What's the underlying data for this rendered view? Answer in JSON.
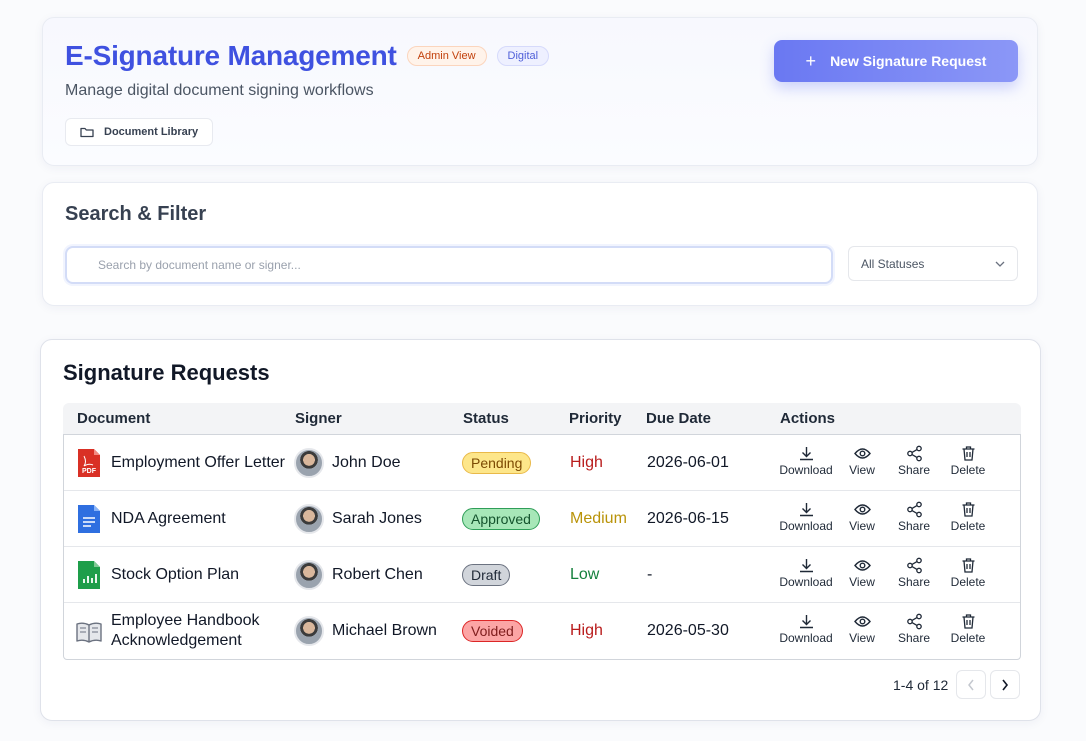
{
  "header": {
    "title": "E-Signature Management",
    "badges": [
      "Admin View",
      "Digital"
    ],
    "subtitle": "Manage digital document signing workflows",
    "doc_library_label": "Document Library",
    "new_request_label": "New Signature Request"
  },
  "search": {
    "title": "Search & Filter",
    "placeholder": "Search by document name or signer...",
    "status_filter": "All Statuses"
  },
  "table": {
    "title": "Signature Requests",
    "columns": [
      "Document",
      "Signer",
      "Status",
      "Priority",
      "Due Date",
      "Actions"
    ],
    "rows": [
      {
        "document": "Employment Offer Letter",
        "doc_icon": "pdf-icon",
        "signer": "John Doe",
        "status": "Pending",
        "priority": "High",
        "due_date": "2026-06-01"
      },
      {
        "document": "NDA Agreement",
        "doc_icon": "doc-icon",
        "signer": "Sarah Jones",
        "status": "Approved",
        "priority": "Medium",
        "due_date": "2026-06-15"
      },
      {
        "document": "Stock Option Plan",
        "doc_icon": "spreadsheet-icon",
        "signer": "Robert Chen",
        "status": "Draft",
        "priority": "Low",
        "due_date": "-"
      },
      {
        "document": "Employee Handbook Acknowledgement",
        "doc_icon": "book-icon",
        "signer": "Michael Brown",
        "status": "Voided",
        "priority": "High",
        "due_date": "2026-05-30"
      }
    ],
    "actions": [
      "Download",
      "View",
      "Share",
      "Delete"
    ],
    "pagination": "1-4 of 12"
  },
  "colors": {
    "accent": "#3f51e0",
    "button": "#6a78f2",
    "pending": "#fde68a",
    "approved": "#a7e7b8",
    "draft": "#d1d5db",
    "voided": "#fca5a5"
  }
}
